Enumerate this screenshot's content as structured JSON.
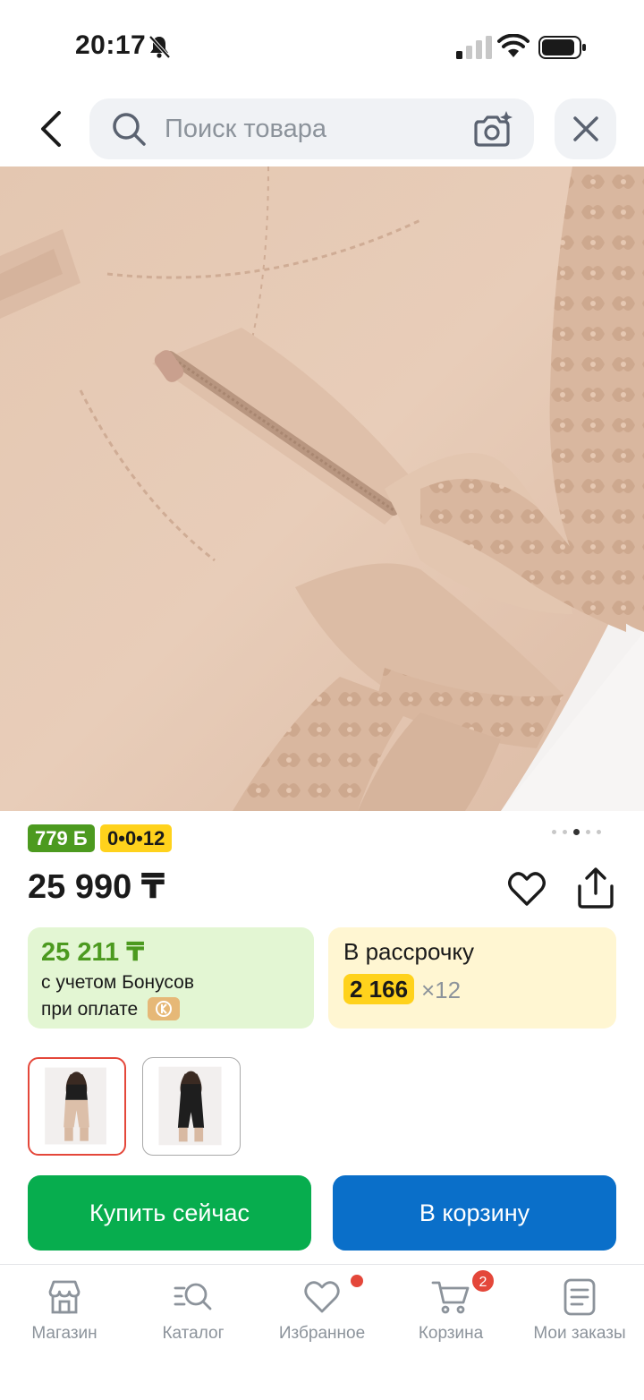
{
  "status_bar": {
    "time": "20:17"
  },
  "header": {
    "search_placeholder": "Поиск товара"
  },
  "product": {
    "image_index": 3,
    "image_count": 5,
    "bonus_badge": "779 Б",
    "installment_badge": "0•0•12",
    "price": "25 990 ₸",
    "bonus_card": {
      "price": "25 211 ₸",
      "note_line1": "с учетом Бонусов",
      "note_line2": "при оплате"
    },
    "installment_card": {
      "title": "В рассрочку",
      "amount": "2 166",
      "times": "×12"
    }
  },
  "actions": {
    "buy_now": "Купить сейчас",
    "add_to_cart": "В корзину"
  },
  "bottom_nav": {
    "items": [
      {
        "label": "Магазин",
        "icon": "shop-icon"
      },
      {
        "label": "Каталог",
        "icon": "catalog-search-icon"
      },
      {
        "label": "Избранное",
        "icon": "heart-icon"
      },
      {
        "label": "Корзина",
        "icon": "cart-icon"
      },
      {
        "label": "Мои заказы",
        "icon": "orders-icon"
      }
    ],
    "cart_count": "2"
  },
  "colors": {
    "green": "#07ad4e",
    "blue": "#0a6fc9",
    "bonus_green": "#4c9a1f",
    "yellow": "#ffd21c",
    "red": "#e4473a"
  }
}
